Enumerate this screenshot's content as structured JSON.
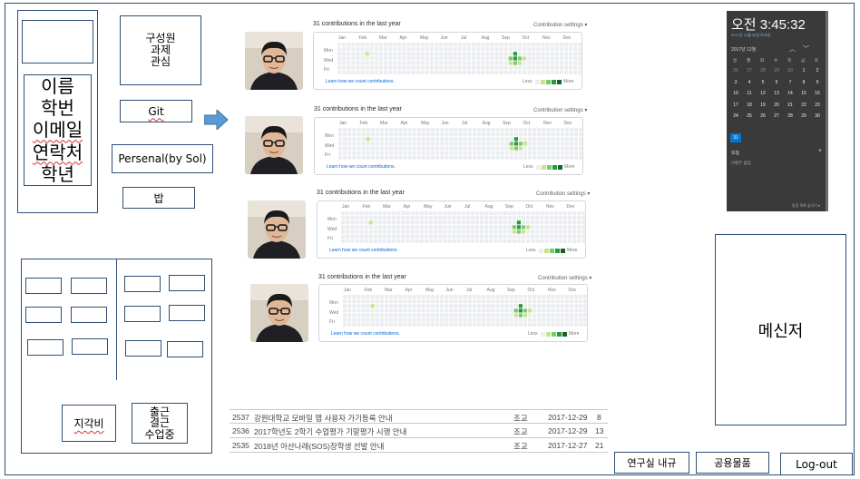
{
  "profile": {
    "lines": [
      "이름",
      "학번",
      "이메일",
      "연락처",
      "학년"
    ]
  },
  "member_box": {
    "text": "구성원\n과제\n관심"
  },
  "buttons": {
    "git": "Git",
    "personal": "Persenal(by Sol)",
    "meal": "밥",
    "late_fee": "지각비",
    "attendance": "출근\n결근\n수업중",
    "lab_rules": "연구실 내규",
    "supplies": "공용물품",
    "logout": "Log-out"
  },
  "messenger": {
    "label": "메신저"
  },
  "contributions": {
    "cards": [
      {
        "title": "31 contributions in the last year",
        "settings": "Contribution settings ▾"
      },
      {
        "title": "31 contributions in the last year",
        "settings": "Contribution settings ▾"
      },
      {
        "title": "31 contributions in the last year",
        "settings": "Contribution settings ▾"
      },
      {
        "title": "31 contributions in the last year",
        "settings": "Contribution settings ▾"
      }
    ],
    "months": [
      "Jan",
      "Feb",
      "Mar",
      "Apr",
      "May",
      "Jun",
      "Jul",
      "Aug",
      "Sep",
      "Oct",
      "Nov",
      "Dec"
    ],
    "days": [
      "Mon",
      "Wed",
      "Fri"
    ],
    "learn": "Learn how we count contributions.",
    "less": "Less",
    "more": "More",
    "legend_colors": [
      "#ebedf0",
      "#c6e48b",
      "#7bc96f",
      "#239a3b",
      "#196127"
    ]
  },
  "calendar": {
    "time": "오전 3:45:32",
    "date": "2017년 12월 30일 토요일",
    "month": "2017년 12월",
    "weekdays": [
      "일",
      "월",
      "화",
      "수",
      "목",
      "금",
      "토"
    ],
    "weeks": [
      [
        "26",
        "27",
        "28",
        "29",
        "30",
        "1",
        "2"
      ],
      [
        "3",
        "4",
        "5",
        "6",
        "7",
        "8",
        "9"
      ],
      [
        "10",
        "11",
        "12",
        "13",
        "14",
        "15",
        "16"
      ],
      [
        "17",
        "18",
        "19",
        "20",
        "21",
        "22",
        "23"
      ],
      [
        "24",
        "25",
        "26",
        "27",
        "28",
        "29",
        "30"
      ],
      [
        "31",
        "",
        "",
        "",
        "",
        "",
        ""
      ]
    ],
    "events_label": "모늘",
    "no_events": "이벤트 없음",
    "hide": "일정 목록 숨기기 ▾"
  },
  "notices": [
    {
      "no": "2537",
      "title": "강원대학교 모바일 앱 사용자 가기등록 안내",
      "author": "조교",
      "date": "2017-12-29",
      "views": "8"
    },
    {
      "no": "2536",
      "title": "2017학년도 2학기 수업평가 기말평가 시행 안내",
      "author": "조교",
      "date": "2017-12-29",
      "views": "13"
    },
    {
      "no": "2535",
      "title": "2018년 아산나래(SOS)장학생 선발 안내",
      "author": "조교",
      "date": "2017-12-27",
      "views": "21"
    }
  ]
}
